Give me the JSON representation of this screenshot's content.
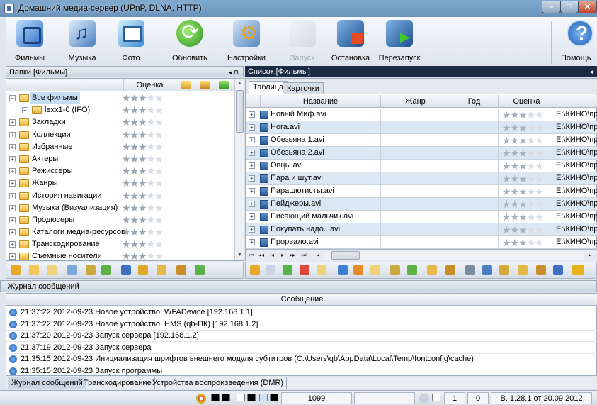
{
  "window": {
    "title": "Домашний медиа-сервер (UPnP, DLNA, HTTP)",
    "min_glyph": "–",
    "max_glyph": "□",
    "close_glyph": "✕"
  },
  "toolbar": {
    "items": [
      {
        "label": "Фильмы",
        "icon": "films-icon"
      },
      {
        "label": "Музыка",
        "icon": "music-icon"
      },
      {
        "label": "Фото",
        "icon": "photo-icon"
      },
      {
        "label": "Обновить",
        "icon": "refresh-icon"
      },
      {
        "label": "Настройки",
        "icon": "settings-icon"
      },
      {
        "label": "Запуск",
        "icon": "launch-icon",
        "disabled": true
      },
      {
        "label": "Остановка",
        "icon": "stop-icon"
      },
      {
        "label": "Перезапуск",
        "icon": "restart-icon"
      },
      {
        "label": "Помощь",
        "icon": "help-icon"
      }
    ]
  },
  "left_panel": {
    "header": "Папки [Фильмы]",
    "pin_glyphs": "◂ ⊓",
    "rating_header": "Оценка",
    "tree": [
      {
        "label": "Все фильмы",
        "level": 0,
        "expander": "−",
        "selected": true,
        "stars": 3
      },
      {
        "label": "lexx1-0 (IFO)",
        "level": 1,
        "expander": "+",
        "stars": 3
      },
      {
        "label": "Закладки",
        "level": 0,
        "expander": "+",
        "stars": 3
      },
      {
        "label": "Коллекции",
        "level": 0,
        "expander": "+",
        "stars": 3
      },
      {
        "label": "Избранные",
        "level": 0,
        "expander": "+",
        "stars": 3
      },
      {
        "label": "Актеры",
        "level": 0,
        "expander": "+",
        "stars": 3
      },
      {
        "label": "Режиссеры",
        "level": 0,
        "expander": "+",
        "stars": 3
      },
      {
        "label": "Жанры",
        "level": 0,
        "expander": "+",
        "stars": 3
      },
      {
        "label": "История навигации",
        "level": 0,
        "expander": "+",
        "stars": 3
      },
      {
        "label": "Музыка (Визуализация)",
        "level": 0,
        "expander": "+",
        "stars": 3
      },
      {
        "label": "Продюсеры",
        "level": 0,
        "expander": "+",
        "stars": 3
      },
      {
        "label": "Каталоги медиа-ресурсов",
        "level": 0,
        "expander": "+",
        "stars": 3
      },
      {
        "label": "Транскодирование",
        "level": 0,
        "expander": "+",
        "stars": 3
      },
      {
        "label": "Съемные носители",
        "level": 0,
        "expander": "+",
        "stars": 3
      }
    ]
  },
  "right_panel": {
    "header": "Список [Фильмы]",
    "pin_glyph": "◂",
    "tabs": [
      "Таблица",
      "Карточки"
    ],
    "active_tab": 0,
    "columns": [
      "Название",
      "Жанр",
      "Год",
      "Оценка"
    ],
    "rows": [
      {
        "name": "Новый Миф.avi",
        "path": "E:\\КИНО\\пр",
        "stars": 3
      },
      {
        "name": "Нога.avi",
        "path": "E:\\КИНО\\пр",
        "stars": 3
      },
      {
        "name": "Обезьяна 1.avi",
        "path": "E:\\КИНО\\пр",
        "stars": 3
      },
      {
        "name": "Обезьяна 2.avi",
        "path": "E:\\КИНО\\пр",
        "stars": 3
      },
      {
        "name": "Овцы.avi",
        "path": "E:\\КИНО\\пр",
        "stars": 3
      },
      {
        "name": "Пара и шут.avi",
        "path": "E:\\КИНО\\пр",
        "stars": 3
      },
      {
        "name": "Парашютисты.avi",
        "path": "E:\\КИНО\\пр",
        "stars": 3
      },
      {
        "name": "Пейджеры.avi",
        "path": "E:\\КИНО\\пр",
        "stars": 3
      },
      {
        "name": "Писающий мальчик.avi",
        "path": "E:\\КИНО\\пр",
        "stars": 3
      },
      {
        "name": "Покупать надо...avi",
        "path": "E:\\КИНО\\пр",
        "stars": 3
      },
      {
        "name": "Прорвало.avi",
        "path": "E:\\КИНО\\пр",
        "stars": 3
      }
    ],
    "nav_glyphs": [
      "⏮",
      "◂◂",
      "◂",
      "▸",
      "▸▸",
      "⏭",
      "◂",
      "▸"
    ]
  },
  "log": {
    "header": "Журнал сообщений",
    "column": "Сообщение",
    "messages": [
      "21:37:22 2012-09-23 Новое устройство: WFADevice [192.168.1.1]",
      "21:37:22 2012-09-23 Новое устройство: HMS (qb-ПК) [192.168.1.2]",
      "21:37:20 2012-09-23 Запуск сервера [192.168.1.2]",
      "21:37:19 2012-09-23 Запуск сервера",
      "21:35:15 2012-09-23 Инициализация шрифтов внешнего модуля субтитров (C:\\Users\\qb\\AppData\\Local\\Temp\\fontconfig\\cache)",
      "21:35:15 2012-09-23 Запуск программы"
    ]
  },
  "bottom_tabs": [
    "Журнал сообщений",
    "Транскодирование",
    "Устройства воспроизведения (DMR)"
  ],
  "status": {
    "count": "1099",
    "field_a": "1",
    "field_b": "0",
    "version": "В. 1.28.1 от 20.09.2012"
  }
}
